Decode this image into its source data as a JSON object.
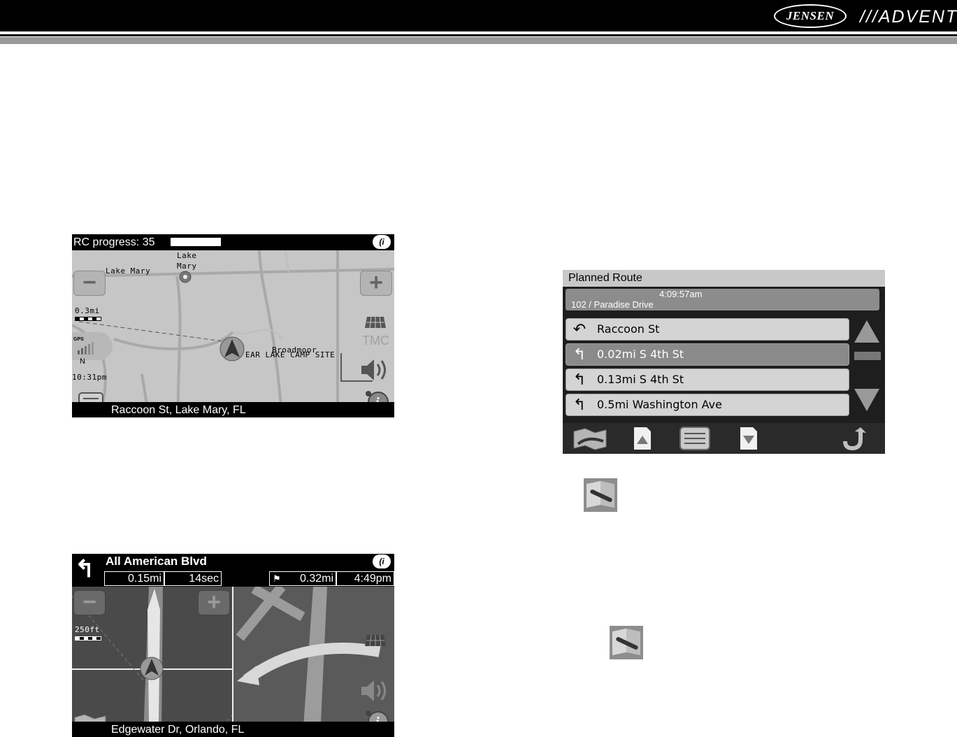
{
  "header": {
    "brand_left": "JENSEN",
    "brand_right": "///ADVENT"
  },
  "screen1": {
    "status": "RC progress: 35",
    "progress_fraction": 0.35,
    "labels": {
      "lake_mary_road": "Lake Mary",
      "lake": "Lake",
      "mary": "Mary",
      "scale": "0.3mi",
      "gps": "GPS",
      "north": "N",
      "time": "10:31pm",
      "broadmoor": "Broadmoor",
      "camp_site": "EAR LAKE CAMP SITE",
      "tmc": "TMC"
    },
    "address": "Raccoon St, Lake Mary, FL"
  },
  "screen2": {
    "title": "Planned Route",
    "time": "4:09:57am",
    "destination": "102 / Paradise Drive",
    "rows": [
      {
        "text": "Raccoon St",
        "icon": "u-turn-icon"
      },
      {
        "text": "0.02mi S 4th St",
        "icon": "turn-left-icon"
      },
      {
        "text": "0.13mi S 4th St",
        "icon": "turn-left-icon"
      },
      {
        "text": "0.5mi Washington Ave",
        "icon": "turn-left-icon"
      }
    ]
  },
  "screen3": {
    "street": "All American Blvd",
    "distance": "0.15mi",
    "eta_sec": "14sec",
    "dest_distance": "0.32mi",
    "arrival": "4:49pm",
    "scale": "250ft",
    "address": "Edgewater Dr, Orlando, FL"
  }
}
